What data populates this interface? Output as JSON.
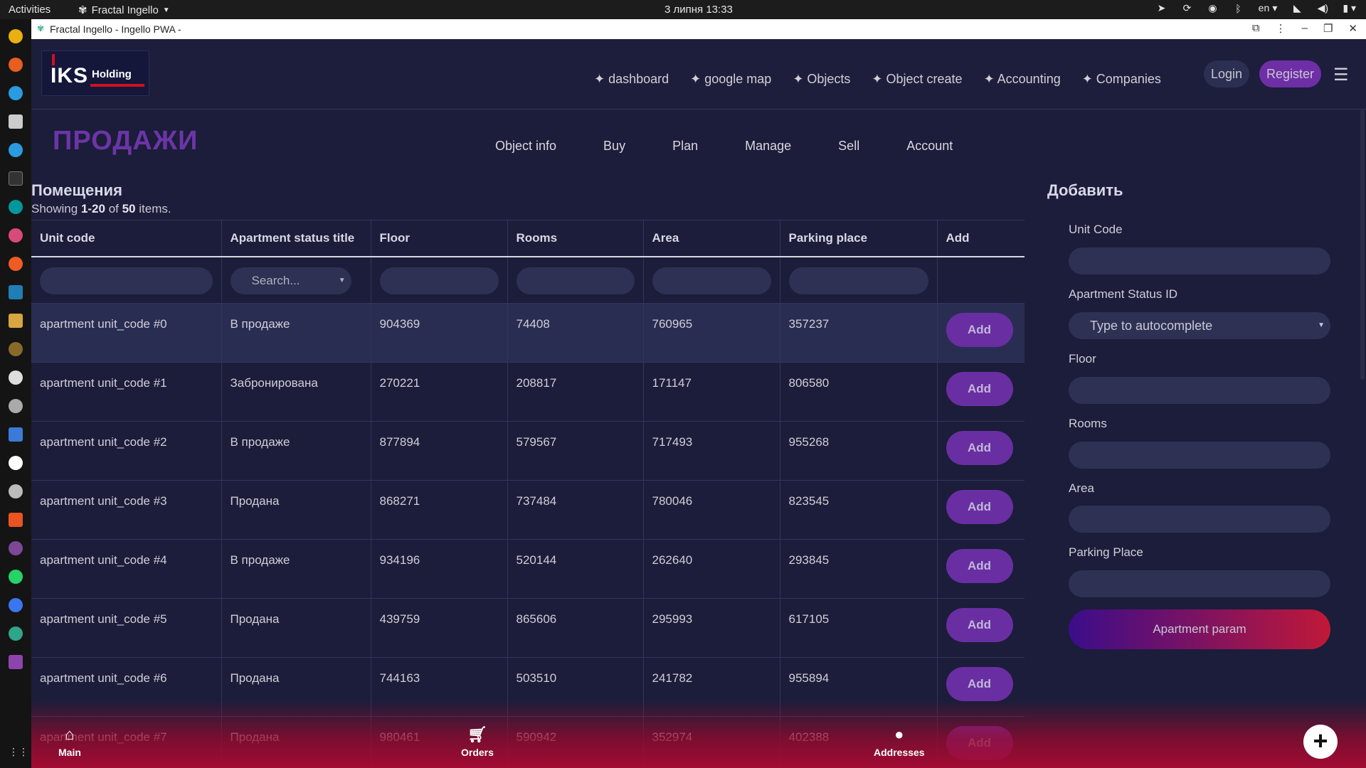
{
  "system": {
    "activities": "Activities",
    "app_name": "Fractal Ingello",
    "clock": "3 липня  13:33",
    "lang": "en"
  },
  "window": {
    "title": "Fractal Ingello - Ingello PWA -"
  },
  "header": {
    "logo_main": "IKS",
    "logo_sub": "Holding",
    "nav": [
      "✦ dashboard",
      "✦ google map",
      "✦ Objects",
      "✦ Object create",
      "✦ Accounting",
      "✦ Companies"
    ],
    "login": "Login",
    "register": "Register"
  },
  "brand_title": "ПРОДАЖИ",
  "subnav": [
    "Object info",
    "Buy",
    "Plan",
    "Manage",
    "Sell",
    "Account"
  ],
  "list": {
    "title": "Помещения",
    "summary_prefix": "Showing ",
    "summary_range": "1-20",
    "summary_mid": " of ",
    "summary_total": "50",
    "summary_suffix": " items.",
    "columns": [
      "Unit code",
      "Apartment status title",
      "Floor",
      "Rooms",
      "Area",
      "Parking place",
      "Add"
    ],
    "filter_placeholder": "Search...",
    "add_label": "Add",
    "rows": [
      {
        "unit": "apartment unit_code #0",
        "status": "В продаже",
        "floor": "904369",
        "rooms": "74408",
        "area": "760965",
        "parking": "357237"
      },
      {
        "unit": "apartment unit_code #1",
        "status": "Забронирована",
        "floor": "270221",
        "rooms": "208817",
        "area": "171147",
        "parking": "806580"
      },
      {
        "unit": "apartment unit_code #2",
        "status": "В продаже",
        "floor": "877894",
        "rooms": "579567",
        "area": "717493",
        "parking": "955268"
      },
      {
        "unit": "apartment unit_code #3",
        "status": "Продана",
        "floor": "868271",
        "rooms": "737484",
        "area": "780046",
        "parking": "823545"
      },
      {
        "unit": "apartment unit_code #4",
        "status": "В продаже",
        "floor": "934196",
        "rooms": "520144",
        "area": "262640",
        "parking": "293845"
      },
      {
        "unit": "apartment unit_code #5",
        "status": "Продана",
        "floor": "439759",
        "rooms": "865606",
        "area": "295993",
        "parking": "617105"
      },
      {
        "unit": "apartment unit_code #6",
        "status": "Продана",
        "floor": "744163",
        "rooms": "503510",
        "area": "241782",
        "parking": "955894"
      },
      {
        "unit": "apartment unit_code #7",
        "status": "Продана",
        "floor": "980461",
        "rooms": "590942",
        "area": "352974",
        "parking": "402388"
      }
    ]
  },
  "form": {
    "title": "Добавить",
    "unit_code": "Unit Code",
    "status_id": "Apartment Status ID",
    "status_placeholder": "Type to autocomplete",
    "floor": "Floor",
    "rooms": "Rooms",
    "area": "Area",
    "parking": "Parking Place",
    "submit": "Apartment param"
  },
  "bottom_nav": {
    "main": "Main",
    "orders": "Orders",
    "addresses": "Addresses",
    "plus": "+"
  }
}
